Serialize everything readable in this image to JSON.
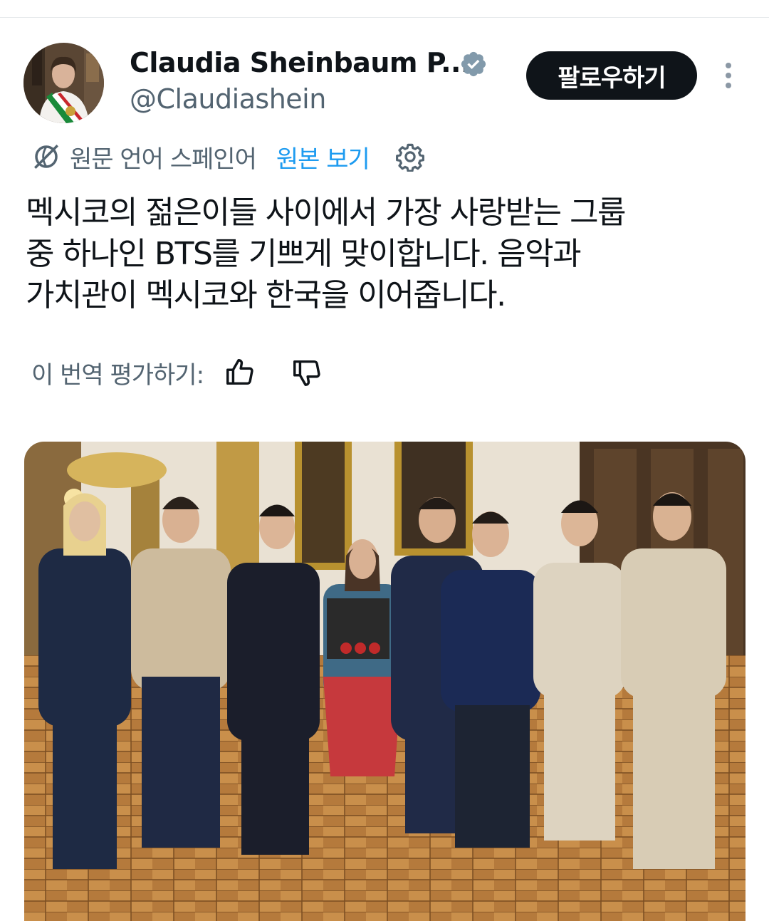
{
  "tweet": {
    "author_name": "Claudia Sheinbaum P...",
    "handle": "@Claudiashein",
    "follow_label": "팔로우하기",
    "translation": {
      "note": "원문 언어 스페인어",
      "show_original": "원본 보기"
    },
    "text_lines": [
      "멕시코의 젊은이들 사이에서 가장 사랑받는 그룹",
      "중 하나인 BTS를 기쁘게 맞이합니다. 음악과",
      "가치관이 멕시코와 한국을 이어줍니다."
    ],
    "rate_label": "이 번역 평가하기:"
  },
  "colors": {
    "text": "#0f1419",
    "secondary": "#536471",
    "link": "#1d9bf0",
    "verified": "#829aab",
    "follow_bg": "#0f1419"
  },
  "icons": [
    "verified-badge-icon",
    "more-icon",
    "globe-icon",
    "gear-icon",
    "thumbs-up-icon",
    "thumbs-down-icon"
  ]
}
